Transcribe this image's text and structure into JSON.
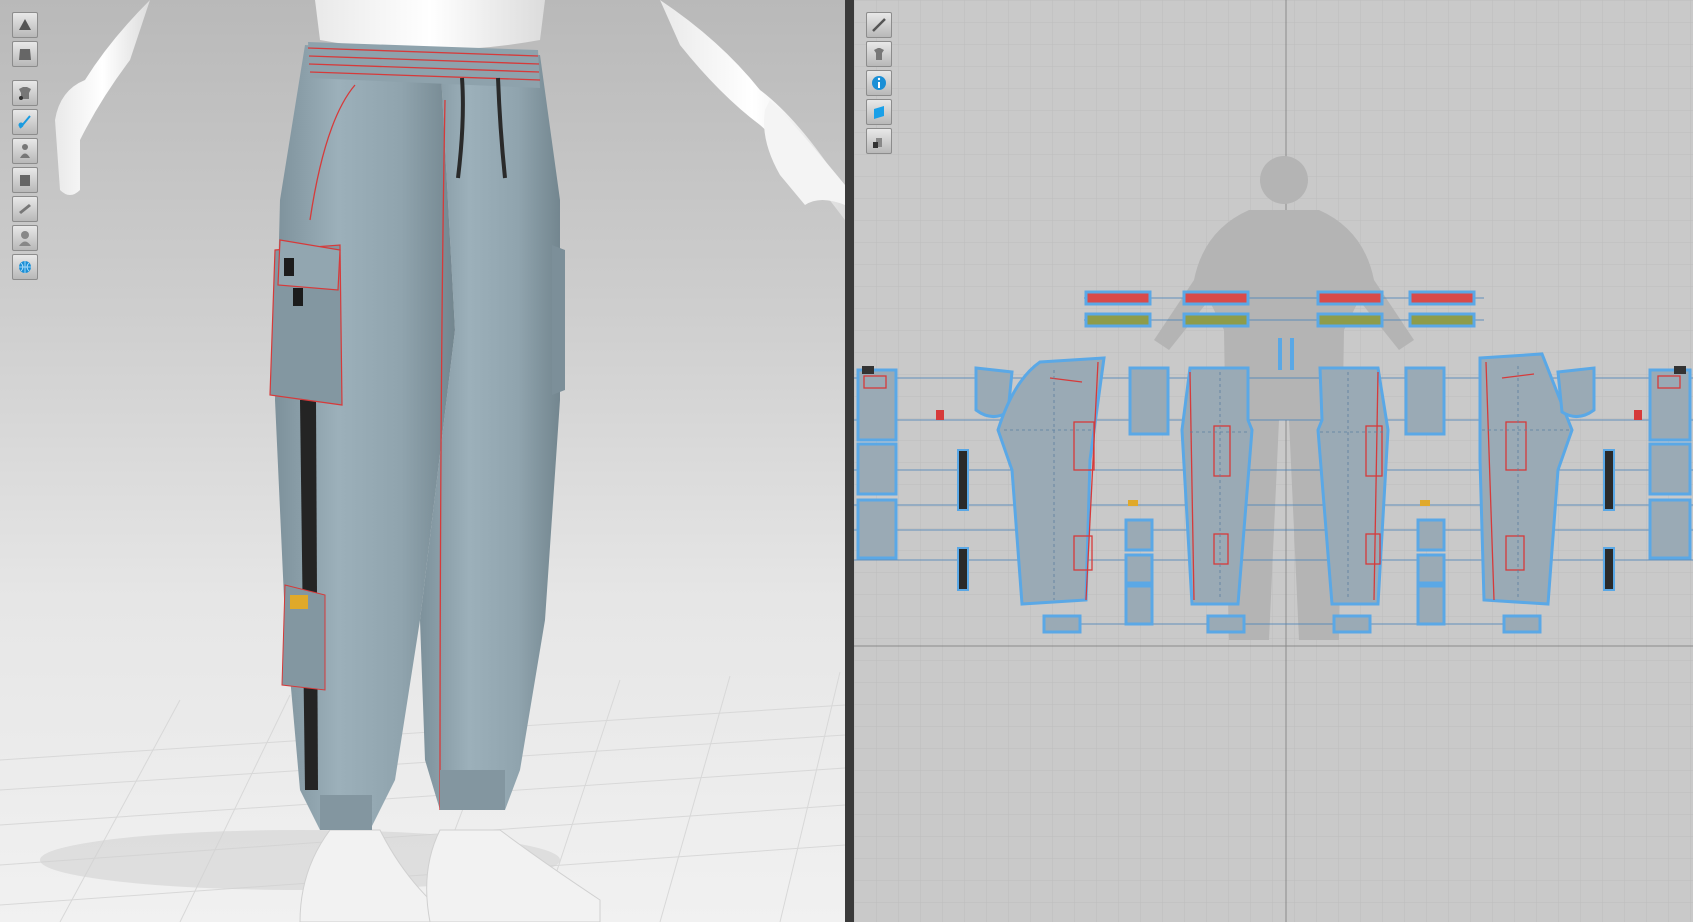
{
  "app": {
    "views": [
      "3d-garment-window",
      "2d-pattern-window"
    ]
  },
  "toolbar_3d": {
    "tools": [
      {
        "name": "avatar-display-icon"
      },
      {
        "name": "garment-display-icon"
      },
      {
        "name": "show-garment-icon"
      },
      {
        "name": "show-pins-icon"
      },
      {
        "name": "show-avatar-icon"
      },
      {
        "name": "show-arrangement-icon"
      },
      {
        "name": "show-measure-icon"
      },
      {
        "name": "avatar-silhouette-icon"
      },
      {
        "name": "texture-globe-icon"
      }
    ]
  },
  "toolbar_2d": {
    "tools": [
      {
        "name": "show-seam-icon"
      },
      {
        "name": "show-garment-2d-icon"
      },
      {
        "name": "info-icon"
      },
      {
        "name": "show-texture-icon"
      },
      {
        "name": "lock-garment-icon"
      }
    ]
  },
  "colors": {
    "fabric": "#8fa3ad",
    "fabric_dark": "#748891",
    "seam": "#d63a3a",
    "pattern_fill": "#9aaab5",
    "pattern_outline": "#5aa8e6",
    "grid_bg": "#c9c9c9",
    "accent_yellow": "#e0a92a"
  }
}
